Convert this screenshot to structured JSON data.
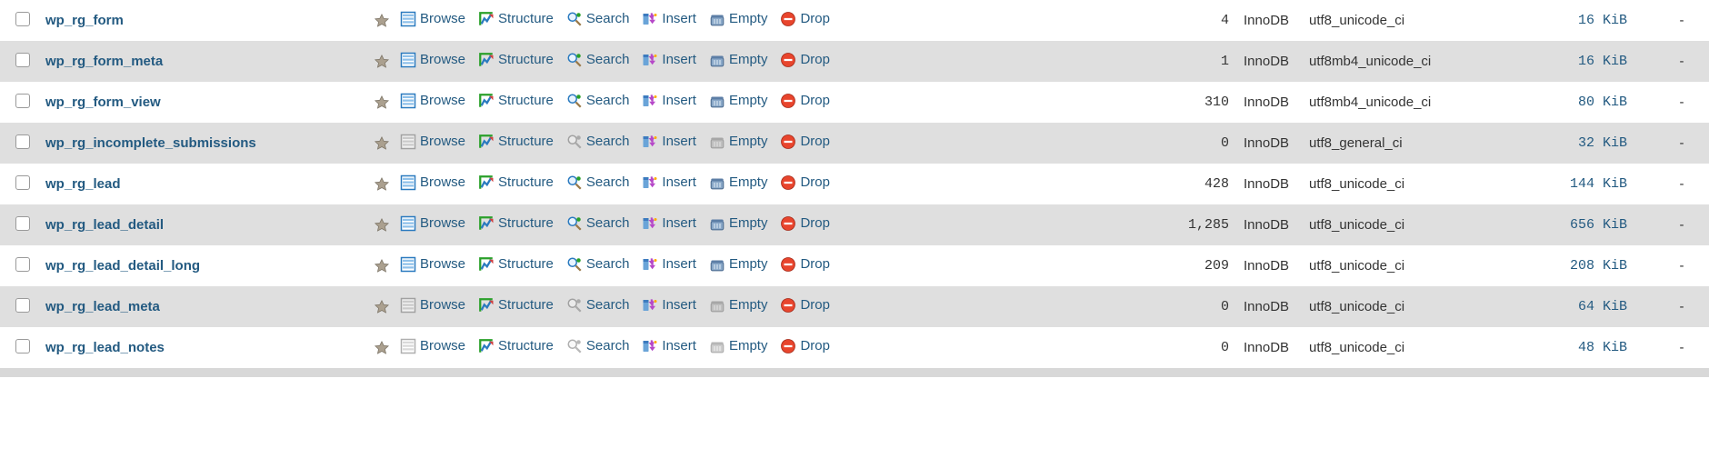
{
  "actionLabels": {
    "browse": "Browse",
    "structure": "Structure",
    "search": "Search",
    "insert": "Insert",
    "empty": "Empty",
    "drop": "Drop"
  },
  "tables": [
    {
      "name": "wp_rg_form",
      "rows": "4",
      "engine": "InnoDB",
      "collation": "utf8_unicode_ci",
      "size": "16 KiB",
      "overhead": "-",
      "disabled": false
    },
    {
      "name": "wp_rg_form_meta",
      "rows": "1",
      "engine": "InnoDB",
      "collation": "utf8mb4_unicode_ci",
      "size": "16 KiB",
      "overhead": "-",
      "disabled": false
    },
    {
      "name": "wp_rg_form_view",
      "rows": "310",
      "engine": "InnoDB",
      "collation": "utf8mb4_unicode_ci",
      "size": "80 KiB",
      "overhead": "-",
      "disabled": false
    },
    {
      "name": "wp_rg_incomplete_submissions",
      "rows": "0",
      "engine": "InnoDB",
      "collation": "utf8_general_ci",
      "size": "32 KiB",
      "overhead": "-",
      "disabled": true
    },
    {
      "name": "wp_rg_lead",
      "rows": "428",
      "engine": "InnoDB",
      "collation": "utf8_unicode_ci",
      "size": "144 KiB",
      "overhead": "-",
      "disabled": false
    },
    {
      "name": "wp_rg_lead_detail",
      "rows": "1,285",
      "engine": "InnoDB",
      "collation": "utf8_unicode_ci",
      "size": "656 KiB",
      "overhead": "-",
      "disabled": false
    },
    {
      "name": "wp_rg_lead_detail_long",
      "rows": "209",
      "engine": "InnoDB",
      "collation": "utf8_unicode_ci",
      "size": "208 KiB",
      "overhead": "-",
      "disabled": false
    },
    {
      "name": "wp_rg_lead_meta",
      "rows": "0",
      "engine": "InnoDB",
      "collation": "utf8_unicode_ci",
      "size": "64 KiB",
      "overhead": "-",
      "disabled": true
    },
    {
      "name": "wp_rg_lead_notes",
      "rows": "0",
      "engine": "InnoDB",
      "collation": "utf8_unicode_ci",
      "size": "48 KiB",
      "overhead": "-",
      "disabled": true
    }
  ]
}
